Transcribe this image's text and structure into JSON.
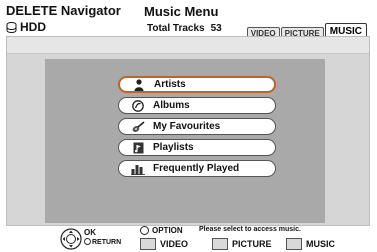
{
  "header": {
    "navigator_title": "DELETE Navigator",
    "drive": "HDD",
    "menu_title": "Music Menu",
    "total_tracks_label": "Total Tracks",
    "total_tracks_value": "53",
    "tabs": [
      "VIDEO",
      "PICTURE",
      "MUSIC"
    ],
    "active_tab": "MUSIC"
  },
  "menu": {
    "items": [
      {
        "label": "Artists",
        "icon": "person-icon",
        "selected": true
      },
      {
        "label": "Albums",
        "icon": "disc-icon",
        "selected": false
      },
      {
        "label": "My Favourites",
        "icon": "guitar-icon",
        "selected": false
      },
      {
        "label": "Playlists",
        "icon": "playlist-icon",
        "selected": false
      },
      {
        "label": "Frequently Played",
        "icon": "bar-chart-icon",
        "selected": false
      }
    ]
  },
  "footer": {
    "ok_label": "OK",
    "return_label": "RETURN",
    "option_label": "OPTION",
    "hint": "Please select to access music.",
    "buttons": [
      "VIDEO",
      "PICTURE",
      "MUSIC"
    ]
  },
  "colors": {
    "selected_border": "#c0622b",
    "panel_bg": "#d6d6d6",
    "inner_bg": "#a9a9a9"
  }
}
